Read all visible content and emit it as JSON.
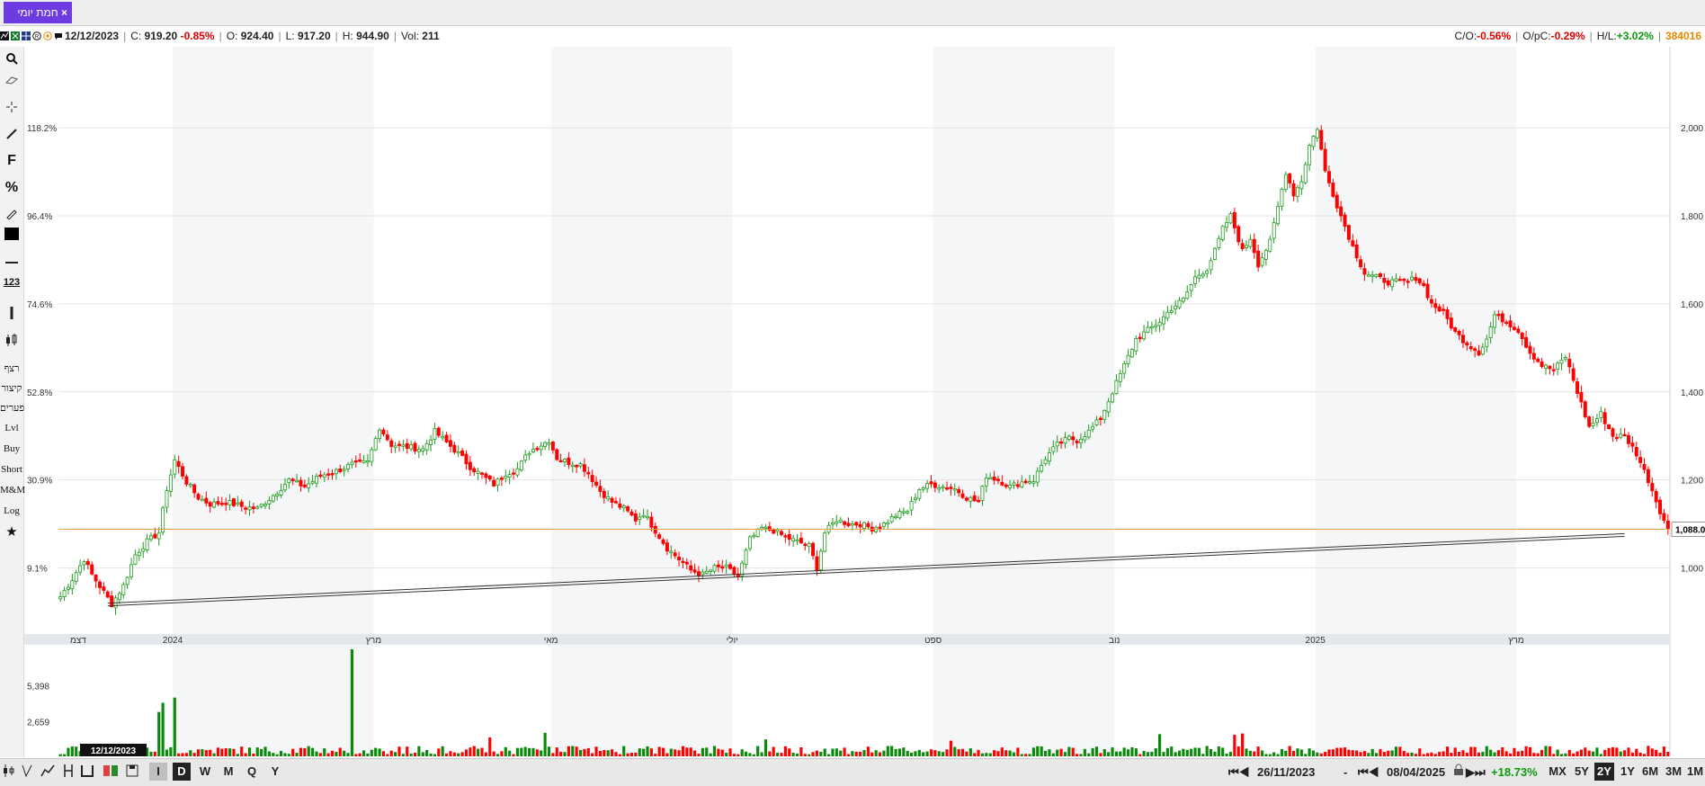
{
  "tab": {
    "label": "חמת יומי",
    "close": "×"
  },
  "info": {
    "date": "12/12/2023",
    "close_label": "C:",
    "close": "919.20",
    "change": "-0.85%",
    "open_label": "O:",
    "open": "924.40",
    "low_label": "L:",
    "low": "917.20",
    "high_label": "H:",
    "high": "944.90",
    "vol_label": "Vol:",
    "vol": "211",
    "co_label": "C/O:",
    "co": "-0.56%",
    "opc_label": "O/pC:",
    "opc": "-0.29%",
    "hl_label": "H/L:",
    "hl": "+3.02%",
    "code": "384016"
  },
  "colors": {
    "up": "#ffffff",
    "up_border": "#1f9a1f",
    "down": "#ff0000",
    "vol_up": "#0a8a0a",
    "vol_down": "#ff0000",
    "hline": "#e8a040",
    "accent": "#6c3ce0"
  },
  "toolbar": {
    "icons": [
      "search-icon",
      "eraser-icon",
      "crosshair-icon",
      "draw-line-icon",
      "fibonacci-icon",
      "percent-icon",
      "edit-icon",
      "color-swatch-icon",
      "horizontal-line-icon",
      "number-icon",
      "vertical-line-icon",
      "candles-icon",
      "star-icon"
    ],
    "f": "F",
    "pct": "%",
    "num": "123",
    "items": [
      "רצף",
      "קיצור",
      "פערים",
      "Lvl",
      "Buy",
      "Short",
      "M&M",
      "Log"
    ]
  },
  "chart_data": {
    "type": "candlestick",
    "ylim": [
      850,
      2180
    ],
    "x_ticks": [
      {
        "index": 5,
        "label": "דצמ"
      },
      {
        "index": 29,
        "label": "2024"
      },
      {
        "index": 80,
        "label": "מרץ"
      },
      {
        "index": 125,
        "label": "מאי"
      },
      {
        "index": 171,
        "label": "יולי"
      },
      {
        "index": 222,
        "label": "ספט"
      },
      {
        "index": 268,
        "label": "נוב"
      },
      {
        "index": 319,
        "label": "2025"
      },
      {
        "index": 370,
        "label": "מרץ"
      }
    ],
    "y_right_ticks": [
      "2,000",
      "1,800",
      "1,600",
      "1,400",
      "1,200",
      "1,000"
    ],
    "y_right_values": [
      2000,
      1800,
      1600,
      1400,
      1200,
      1000
    ],
    "y_left_ticks": [
      "118.2%",
      "96.4%",
      "74.6%",
      "52.8%",
      "30.9%",
      "9.1%"
    ],
    "y_left_values": [
      2000,
      1800,
      1600,
      1400,
      1200,
      1000
    ],
    "last_price_label": "1,088.00",
    "last_price": 1088,
    "trendline": {
      "start_index": 12,
      "start_value": 920,
      "end_index": 397,
      "end_value": 1078
    },
    "volume_ticks": [
      "5,398",
      "2,659"
    ],
    "volume_tick_values": [
      5398,
      2659
    ],
    "volume_max": 8200,
    "cursor_date_label": "12/12/2023",
    "anchors": [
      [
        0,
        935
      ],
      [
        3,
        975
      ],
      [
        6,
        1020
      ],
      [
        8,
        985
      ],
      [
        11,
        945
      ],
      [
        13,
        918
      ],
      [
        16,
        960
      ],
      [
        19,
        1030
      ],
      [
        22,
        1060
      ],
      [
        25,
        1080
      ],
      [
        27,
        1180
      ],
      [
        29,
        1245
      ],
      [
        32,
        1195
      ],
      [
        35,
        1160
      ],
      [
        38,
        1145
      ],
      [
        42,
        1150
      ],
      [
        46,
        1140
      ],
      [
        50,
        1135
      ],
      [
        54,
        1165
      ],
      [
        58,
        1200
      ],
      [
        62,
        1185
      ],
      [
        66,
        1210
      ],
      [
        70,
        1220
      ],
      [
        74,
        1235
      ],
      [
        78,
        1240
      ],
      [
        81,
        1320
      ],
      [
        84,
        1280
      ],
      [
        88,
        1275
      ],
      [
        92,
        1270
      ],
      [
        95,
        1310
      ],
      [
        98,
        1285
      ],
      [
        101,
        1260
      ],
      [
        104,
        1230
      ],
      [
        107,
        1210
      ],
      [
        110,
        1190
      ],
      [
        113,
        1215
      ],
      [
        116,
        1225
      ],
      [
        119,
        1265
      ],
      [
        122,
        1280
      ],
      [
        124,
        1290
      ],
      [
        126,
        1250
      ],
      [
        129,
        1240
      ],
      [
        132,
        1235
      ],
      [
        134,
        1215
      ],
      [
        137,
        1175
      ],
      [
        140,
        1150
      ],
      [
        143,
        1135
      ],
      [
        146,
        1110
      ],
      [
        148,
        1125
      ],
      [
        151,
        1085
      ],
      [
        154,
        1045
      ],
      [
        157,
        1020
      ],
      [
        160,
        995
      ],
      [
        163,
        985
      ],
      [
        166,
        1000
      ],
      [
        169,
        1000
      ],
      [
        172,
        980
      ],
      [
        175,
        1065
      ],
      [
        178,
        1090
      ],
      [
        181,
        1085
      ],
      [
        184,
        1070
      ],
      [
        187,
        1060
      ],
      [
        190,
        1050
      ],
      [
        192,
        1000
      ],
      [
        194,
        1080
      ],
      [
        197,
        1110
      ],
      [
        200,
        1100
      ],
      [
        203,
        1100
      ],
      [
        206,
        1090
      ],
      [
        209,
        1100
      ],
      [
        212,
        1120
      ],
      [
        215,
        1130
      ],
      [
        218,
        1180
      ],
      [
        221,
        1190
      ],
      [
        224,
        1185
      ],
      [
        227,
        1180
      ],
      [
        230,
        1160
      ],
      [
        233,
        1150
      ],
      [
        235,
        1210
      ],
      [
        238,
        1200
      ],
      [
        241,
        1185
      ],
      [
        244,
        1195
      ],
      [
        247,
        1200
      ],
      [
        250,
        1250
      ],
      [
        253,
        1280
      ],
      [
        256,
        1295
      ],
      [
        258,
        1290
      ],
      [
        261,
        1310
      ],
      [
        264,
        1340
      ],
      [
        267,
        1400
      ],
      [
        270,
        1460
      ],
      [
        273,
        1520
      ],
      [
        276,
        1540
      ],
      [
        279,
        1560
      ],
      [
        282,
        1590
      ],
      [
        285,
        1610
      ],
      [
        288,
        1660
      ],
      [
        291,
        1680
      ],
      [
        293,
        1720
      ],
      [
        295,
        1770
      ],
      [
        297,
        1800
      ],
      [
        300,
        1720
      ],
      [
        302,
        1750
      ],
      [
        304,
        1690
      ],
      [
        307,
        1740
      ],
      [
        309,
        1820
      ],
      [
        311,
        1900
      ],
      [
        313,
        1850
      ],
      [
        315,
        1880
      ],
      [
        317,
        1960
      ],
      [
        319,
        2000
      ],
      [
        321,
        1900
      ],
      [
        323,
        1850
      ],
      [
        325,
        1800
      ],
      [
        328,
        1730
      ],
      [
        331,
        1670
      ],
      [
        334,
        1660
      ],
      [
        337,
        1650
      ],
      [
        340,
        1650
      ],
      [
        342,
        1650
      ],
      [
        344,
        1660
      ],
      [
        346,
        1640
      ],
      [
        348,
        1600
      ],
      [
        351,
        1580
      ],
      [
        354,
        1535
      ],
      [
        357,
        1510
      ],
      [
        360,
        1490
      ],
      [
        362,
        1520
      ],
      [
        364,
        1575
      ],
      [
        367,
        1560
      ],
      [
        370,
        1540
      ],
      [
        373,
        1490
      ],
      [
        376,
        1460
      ],
      [
        379,
        1450
      ],
      [
        382,
        1480
      ],
      [
        385,
        1400
      ],
      [
        388,
        1320
      ],
      [
        391,
        1350
      ],
      [
        394,
        1300
      ],
      [
        397,
        1300
      ],
      [
        400,
        1260
      ],
      [
        403,
        1200
      ],
      [
        406,
        1130
      ],
      [
        408,
        1088
      ]
    ],
    "volume_spikes": [
      {
        "index": 25,
        "value": 3400
      },
      {
        "index": 26,
        "value": 4100
      },
      {
        "index": 29,
        "value": 4500
      },
      {
        "index": 74,
        "value": 8200
      },
      {
        "index": 109,
        "value": 1450
      },
      {
        "index": 123,
        "value": 1800
      },
      {
        "index": 179,
        "value": 1300
      },
      {
        "index": 226,
        "value": 1200
      },
      {
        "index": 279,
        "value": 1700
      },
      {
        "index": 298,
        "value": 1650
      },
      {
        "index": 300,
        "value": 1750
      }
    ]
  },
  "bottom": {
    "timeframes": [
      "I",
      "D",
      "W",
      "M",
      "Q",
      "Y"
    ],
    "selected_timeframe": "D",
    "start_date": "26/11/2023",
    "dash": "-",
    "end_date": "08/04/2025",
    "change": "+18.73%",
    "ranges": [
      "MX",
      "5Y",
      "2Y",
      "1Y",
      "6M",
      "3M",
      "1M"
    ],
    "selected_range": "2Y",
    "rewind_start": "⏮◀",
    "rewind_end": "⏮◀",
    "forward_end": "▶⏭"
  }
}
